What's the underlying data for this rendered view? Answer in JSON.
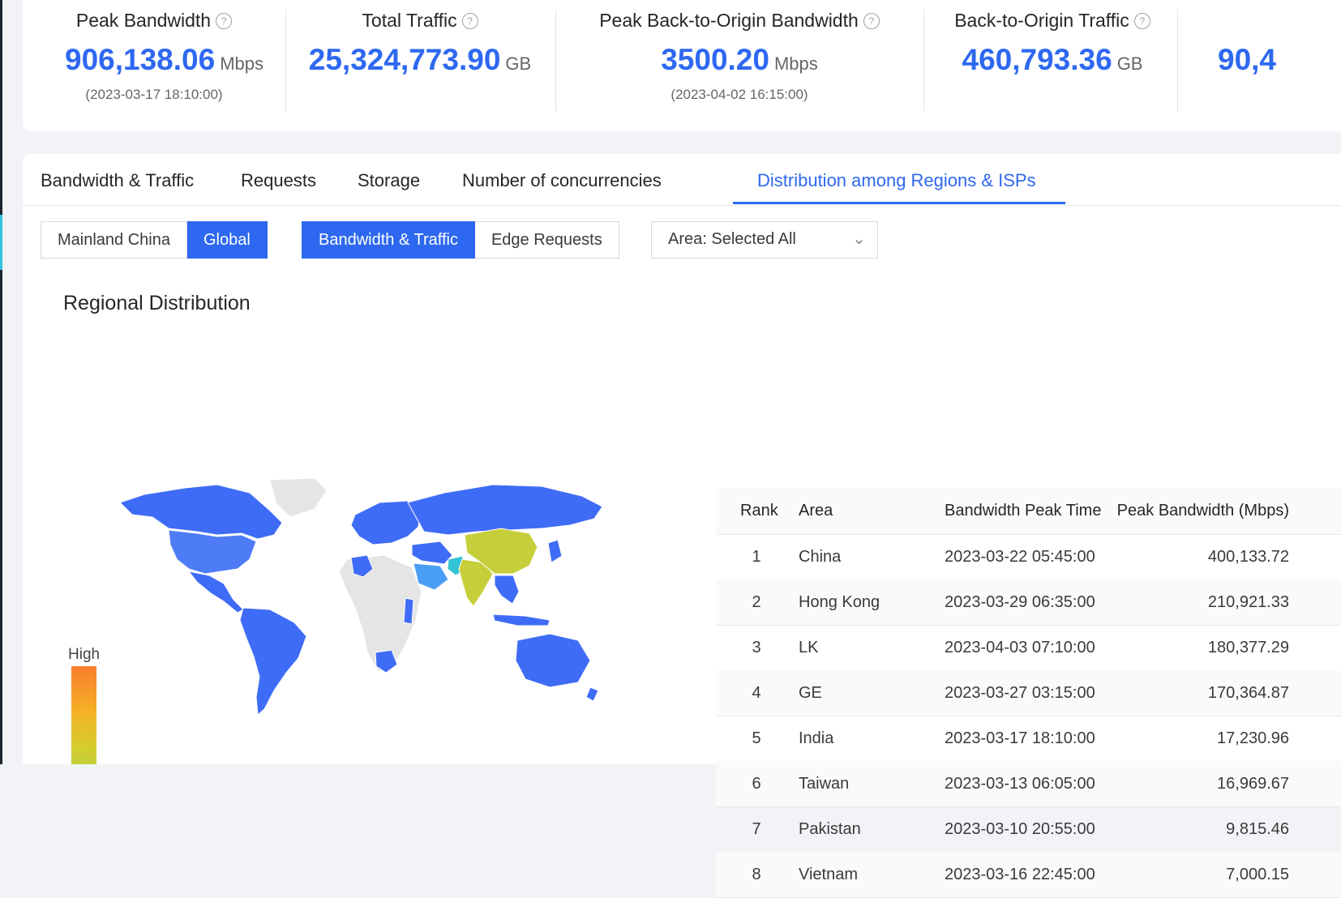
{
  "metrics": [
    {
      "title": "Peak Bandwidth",
      "value": "906,138.06",
      "unit": "Mbps",
      "time": "(2023-03-17 18:10:00)"
    },
    {
      "title": "Total Traffic",
      "value": "25,324,773.90",
      "unit": "GB",
      "time": ""
    },
    {
      "title": "Peak Back-to-Origin Bandwidth",
      "value": "3500.20",
      "unit": "Mbps",
      "time": "(2023-04-02 16:15:00)"
    },
    {
      "title": "Back-to-Origin Traffic",
      "value": "460,793.36",
      "unit": "GB",
      "time": ""
    },
    {
      "title": "",
      "value": "90,4",
      "unit": "",
      "time": ""
    }
  ],
  "help_glyph": "?",
  "tabs": [
    {
      "label": "Bandwidth & Traffic"
    },
    {
      "label": "Requests"
    },
    {
      "label": "Storage"
    },
    {
      "label": "Number of concurrencies"
    },
    {
      "label": "Distribution among Regions & ISPs"
    }
  ],
  "active_tab": "Distribution among Regions & ISPs",
  "filters": {
    "scope": [
      "Mainland China",
      "Global"
    ],
    "scope_selected": "Global",
    "metric": [
      "Bandwidth & Traffic",
      "Edge Requests"
    ],
    "metric_selected": "Bandwidth & Traffic",
    "area_dropdown": "Area: Selected All"
  },
  "section_title": "Regional Distribution",
  "legend": {
    "high_label": "High"
  },
  "table": {
    "headers": [
      "Rank",
      "Area",
      "Bandwidth Peak Time",
      "Peak Bandwidth (Mbps)"
    ],
    "rows": [
      {
        "rank": "1",
        "area": "China",
        "time": "2023-03-22 05:45:00",
        "bw": "400,133.72"
      },
      {
        "rank": "2",
        "area": "Hong Kong",
        "time": "2023-03-29 06:35:00",
        "bw": "210,921.33"
      },
      {
        "rank": "3",
        "area": "LK",
        "time": "2023-04-03 07:10:00",
        "bw": "180,377.29"
      },
      {
        "rank": "4",
        "area": "GE",
        "time": "2023-03-27 03:15:00",
        "bw": "170,364.87"
      },
      {
        "rank": "5",
        "area": "India",
        "time": "2023-03-17 18:10:00",
        "bw": "17,230.96"
      },
      {
        "rank": "6",
        "area": "Taiwan",
        "time": "2023-03-13 06:05:00",
        "bw": "16,969.67"
      },
      {
        "rank": "7",
        "area": "Pakistan",
        "time": "2023-03-10 20:55:00",
        "bw": "9,815.46"
      },
      {
        "rank": "8",
        "area": "Vietnam",
        "time": "2023-03-16 22:45:00",
        "bw": "7,000.15"
      }
    ]
  },
  "colors": {
    "accent": "#2e68f0",
    "map_default": "#3f6cf6",
    "map_nodata": "#e5e5e5",
    "map_high": "#c6cf3a",
    "map_mid": "#4a9ef5",
    "map_teal": "#33c4d6"
  }
}
